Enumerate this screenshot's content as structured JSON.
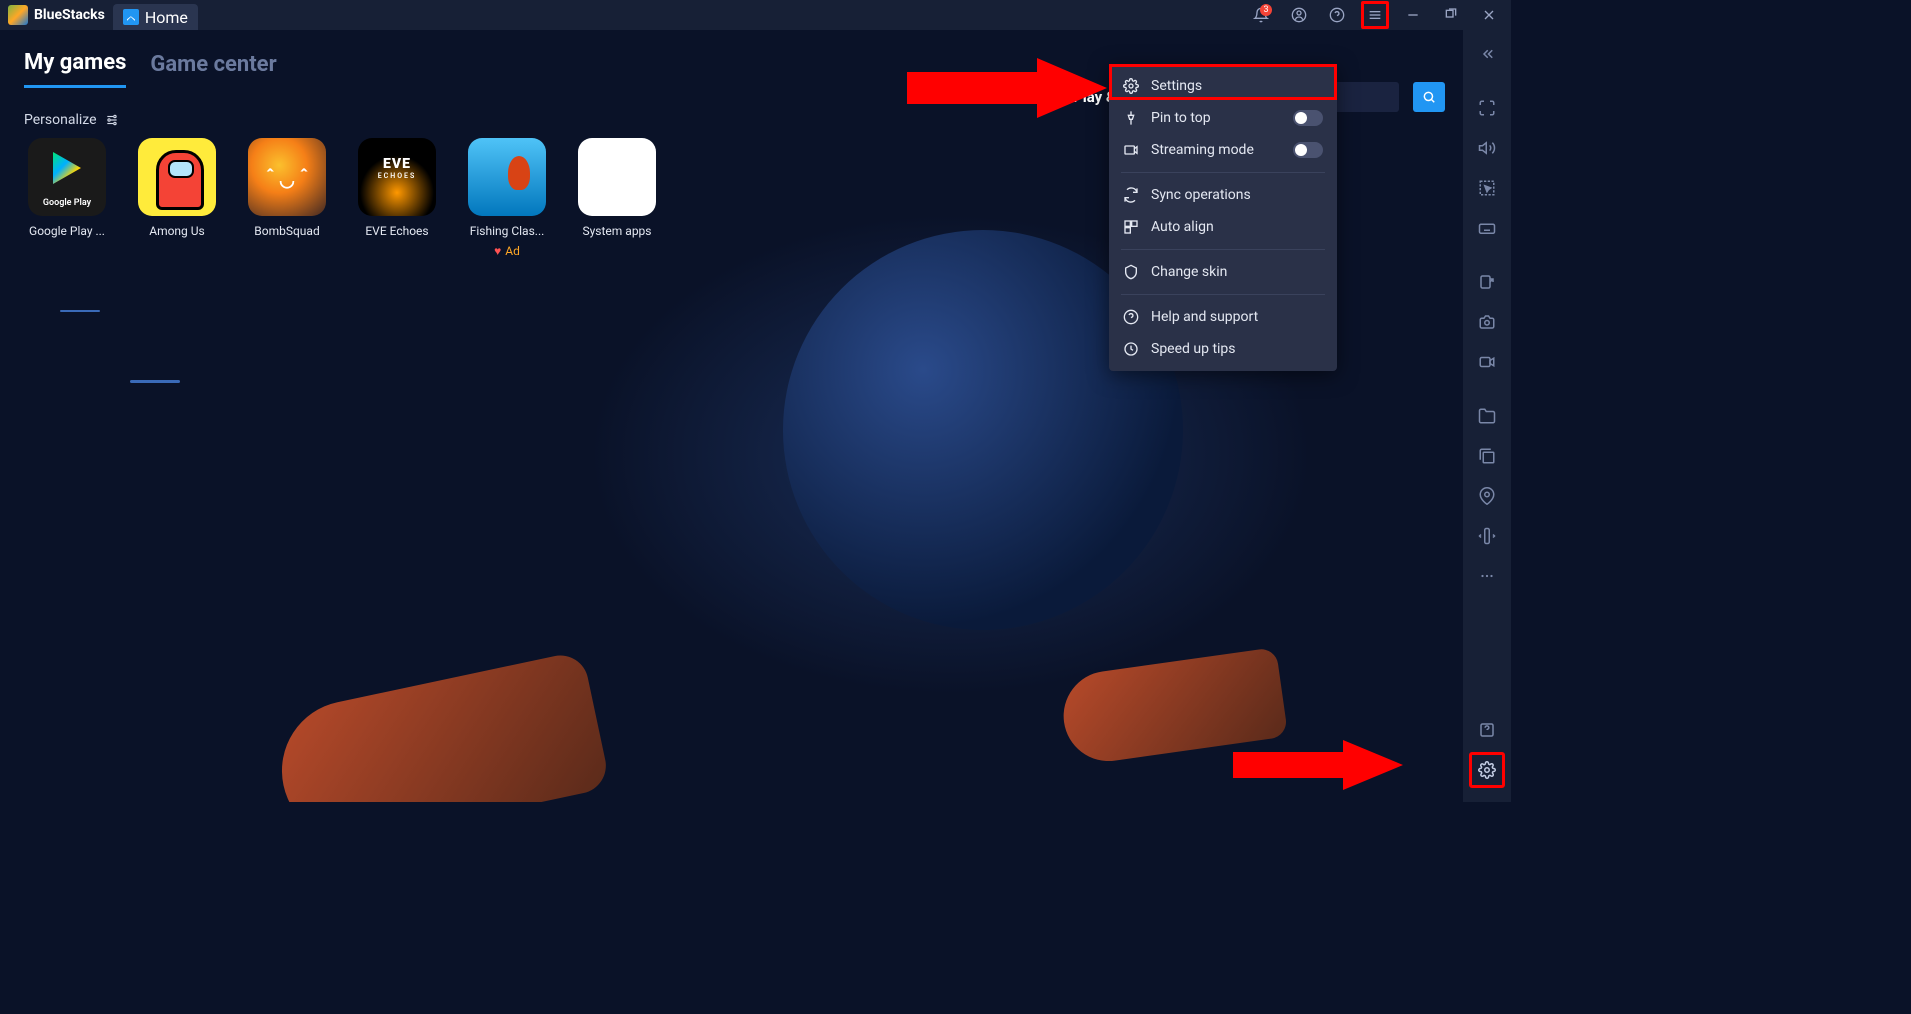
{
  "titleBar": {
    "brand": "BlueStacks",
    "homeTab": "Home",
    "notifCount": "3"
  },
  "nav": {
    "myGames": "My games",
    "gameCenter": "Game center",
    "personalize": "Personalize"
  },
  "topActions": {
    "playWin": "Play & Win"
  },
  "apps": {
    "googlePlay": "Google Play ...",
    "amongUs": "Among Us",
    "bombSquad": "BombSquad",
    "eveEchoes": "EVE Echoes",
    "fishingClash": "Fishing Clas...",
    "systemApps": "System apps",
    "adLabel": "Ad"
  },
  "dropdown": {
    "settings": "Settings",
    "pinToTop": "Pin to top",
    "streamingMode": "Streaming mode",
    "syncOperations": "Sync operations",
    "autoAlign": "Auto align",
    "changeSkin": "Change skin",
    "helpSupport": "Help and support",
    "speedUpTips": "Speed up tips"
  }
}
